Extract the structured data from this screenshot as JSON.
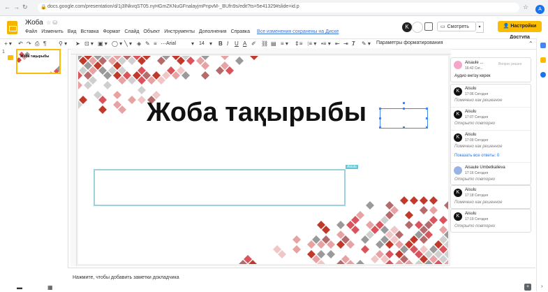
{
  "browser": {
    "url": "docs.google.com/presentation/d/1j3lNkvqST05.nyHGmZKNuGFnalayjmPnpvM-_BUfn9s/edit?ts=5e41329#slide=id.p",
    "user_initial": "A"
  },
  "header": {
    "doc_title": "Жоба",
    "menu": [
      "Файл",
      "Изменить",
      "Вид",
      "Вставка",
      "Формат",
      "Слайд",
      "Объект",
      "Инструменты",
      "Дополнения",
      "Справка"
    ],
    "saved_status": "Все изменения сохранены на Диске",
    "avatar_initial": "K",
    "present_label": "Смотреть",
    "share_label": "Настройки Доступа"
  },
  "toolbar": {
    "font_name": "Arial",
    "font_size": "14",
    "format_options": "Параметры форматирования"
  },
  "filmstrip": {
    "slide_number": "1",
    "thumb_title": "Жоба тақырыбы"
  },
  "slide": {
    "title": "Жоба тақырыбы",
    "collaborator_tag": "Aisulu"
  },
  "notes": {
    "placeholder": "Нажмите, чтобы добавить заметки докладчика"
  },
  "comments": {
    "c1": {
      "author": "Aisaule ...",
      "time": "16:42 Сег...",
      "resolve": "Вопрос решен",
      "body": "Аудио енгізу керек"
    },
    "c2": {
      "author": "Aisulu",
      "time": "17:06 Сегодня",
      "status": "Помечено как решенное"
    },
    "c3": {
      "author": "Aisulu",
      "time": "17:07 Сегодня",
      "status": "Открыто повторно"
    },
    "c4": {
      "author": "Aisulu",
      "time": "17:09 Сегодня",
      "status": "Помечено как решенное"
    },
    "show_all": "Показать все ответы: 0",
    "c5": {
      "author": "Aisaule Umbetkalieva",
      "time": "17:16 Сегодня",
      "status": "Открыто повторно"
    },
    "c6": {
      "author": "Aisulu",
      "time": "17:18 Сегодня",
      "status": "Помечено как решенное"
    },
    "c7": {
      "author": "Aisulu",
      "time": "17:19 Сегодня",
      "status": "Открыто повторно"
    }
  },
  "colors": {
    "accent_yellow": "#fbbc04",
    "link_blue": "#1a73e8",
    "diamond_red": "#d9545c"
  }
}
